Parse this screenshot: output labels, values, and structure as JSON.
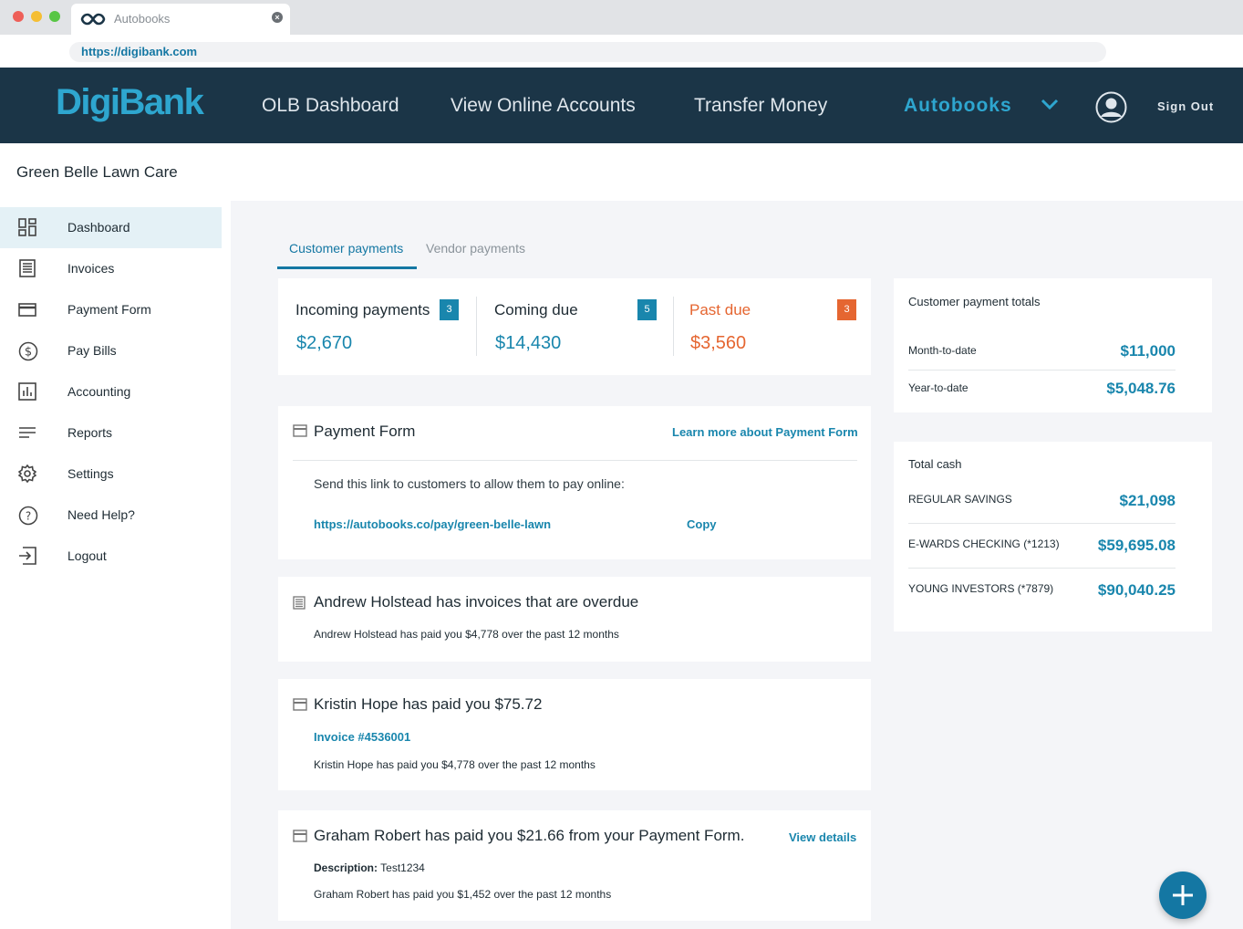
{
  "browser": {
    "tab_title": "Autobooks",
    "url": "https://digibank.com"
  },
  "header": {
    "brand": "DigiBank",
    "nav": [
      "OLB Dashboard",
      "View Online Accounts",
      "Transfer Money",
      "Autobooks"
    ],
    "sign_out": "Sign Out"
  },
  "business_name": "Green Belle Lawn Care",
  "sidebar": {
    "items": [
      {
        "label": "Dashboard",
        "icon": "dashboard-icon"
      },
      {
        "label": "Invoices",
        "icon": "invoice-icon"
      },
      {
        "label": "Payment Form",
        "icon": "card-icon"
      },
      {
        "label": "Pay Bills",
        "icon": "dollar-icon"
      },
      {
        "label": "Accounting",
        "icon": "chart-icon"
      },
      {
        "label": "Reports",
        "icon": "lines-icon"
      },
      {
        "label": "Settings",
        "icon": "gear-icon"
      },
      {
        "label": "Need Help?",
        "icon": "help-icon"
      },
      {
        "label": "Logout",
        "icon": "logout-icon"
      }
    ]
  },
  "tabs": {
    "customer": "Customer payments",
    "vendor": "Vendor payments"
  },
  "summary": [
    {
      "label": "Incoming payments",
      "count": "3",
      "amount": "$2,670"
    },
    {
      "label": "Coming due",
      "count": "5",
      "amount": "$14,430"
    },
    {
      "label": "Past due",
      "count": "3",
      "amount": "$3,560"
    }
  ],
  "payment_form": {
    "title": "Payment Form",
    "learn_more": "Learn more about Payment Form",
    "instructions": "Send this link to customers to allow them to pay online:",
    "link": "https://autobooks.co/pay/green-belle-lawn",
    "copy": "Copy"
  },
  "feed": {
    "overdue": {
      "title": "Andrew Holstead has invoices that are overdue",
      "detail": "Andrew Holstead has paid you $4,778 over the past 12 months"
    },
    "paid": {
      "title": "Kristin Hope has paid you $75.72",
      "invoice": "Invoice #4536001",
      "detail": "Kristin Hope has paid you $4,778 over the past 12 months"
    },
    "form_payment": {
      "title": "Graham Robert has paid you $21.66 from your Payment Form.",
      "view_details": "View details",
      "description_label": "Description:",
      "description_value": "Test1234",
      "detail": "Graham Robert has paid you $1,452 over the past 12 months"
    }
  },
  "totals": {
    "title": "Customer payment totals",
    "rows": [
      {
        "label": "Month-to-date",
        "value": "$11,000"
      },
      {
        "label": "Year-to-date",
        "value": "$5,048.76"
      }
    ]
  },
  "cash": {
    "title": "Total cash",
    "rows": [
      {
        "label": "REGULAR SAVINGS",
        "value": "$21,098"
      },
      {
        "label": "E-WARDS CHECKING (*1213)",
        "value": "$59,695.08"
      },
      {
        "label": "YOUNG INVESTORS (*7879)",
        "value": "$90,040.25"
      }
    ]
  },
  "colors": {
    "header_bg": "#1b3547",
    "accent": "#1986ad",
    "brand": "#2ea6cf",
    "past_due": "#e56631",
    "main_bg": "#f4f5f8"
  }
}
